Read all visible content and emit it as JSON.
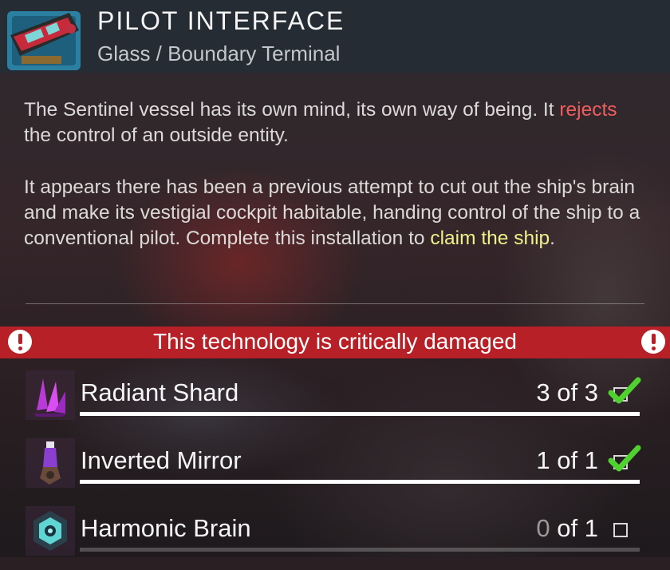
{
  "header": {
    "title": "PILOT INTERFACE",
    "subtitle": "Glass / Boundary Terminal",
    "icon": "pilot-interface-tech-icon"
  },
  "description": {
    "p1_before": "The Sentinel vessel has its own mind, its own way of being. It ",
    "p1_highlight": "rejects",
    "p1_after": " the control of an outside entity.",
    "p2_before": "It appears there has been a previous attempt to cut out the ship's brain and make its vestigial cockpit habitable, handing control of the ship to a conventional pilot. Complete this installation to ",
    "p2_highlight": "claim the ship",
    "p2_after": "."
  },
  "alert": {
    "text": "This technology is critically damaged",
    "icon": "exclamation-icon",
    "color": "#b72026"
  },
  "components": [
    {
      "name": "Radiant Shard",
      "have": "3",
      "of": "of",
      "need": "3",
      "complete": true,
      "icon": "radiant-shard-icon"
    },
    {
      "name": "Inverted Mirror",
      "have": "1",
      "of": "of",
      "need": "1",
      "complete": true,
      "icon": "inverted-mirror-icon"
    },
    {
      "name": "Harmonic Brain",
      "have": "0",
      "of": "of",
      "need": "1",
      "complete": false,
      "icon": "harmonic-brain-icon"
    }
  ],
  "colors": {
    "highlight_red": "#ef5d5d",
    "highlight_yellow": "#eef08a",
    "check_green": "#4fd12f"
  }
}
